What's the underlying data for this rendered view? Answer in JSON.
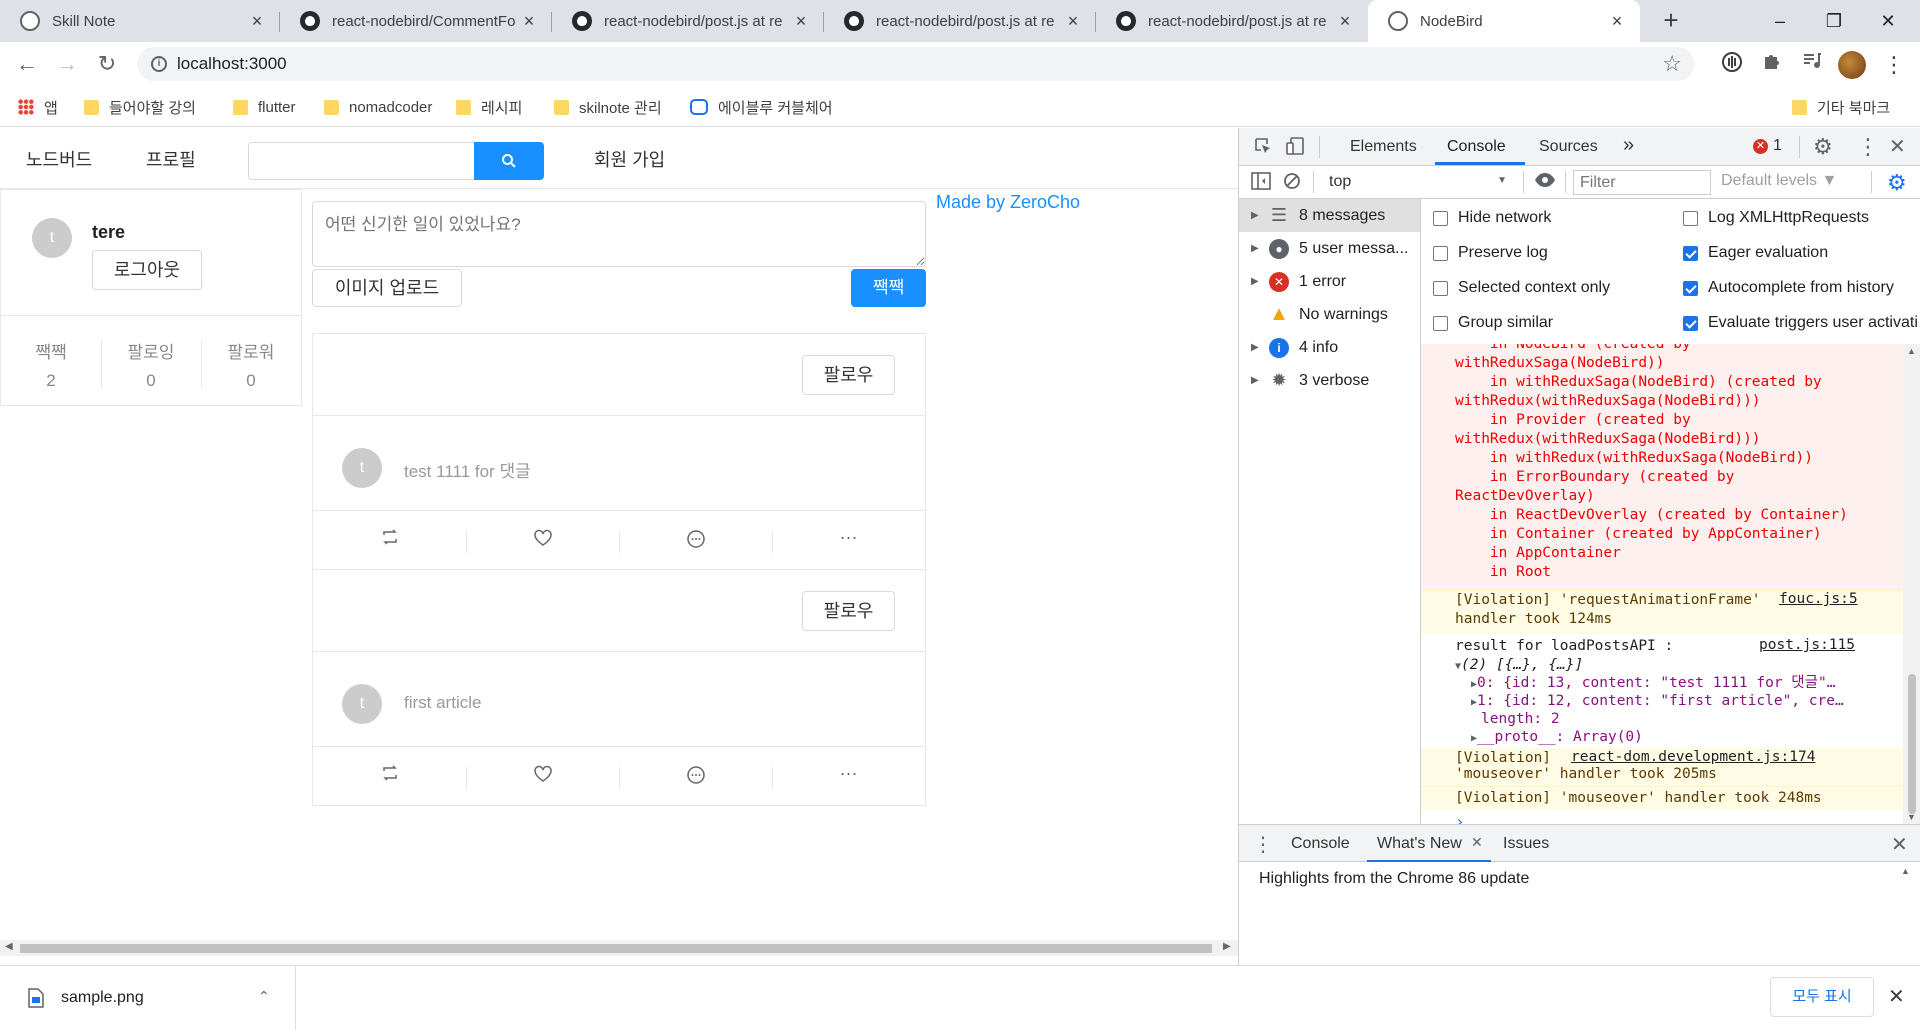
{
  "tabs": [
    {
      "title": "Skill Note",
      "icon": "globe-icon",
      "active": false
    },
    {
      "title": "react-nodebird/CommentFo",
      "icon": "github-icon",
      "active": false
    },
    {
      "title": "react-nodebird/post.js at re",
      "icon": "github-icon",
      "active": false
    },
    {
      "title": "react-nodebird/post.js at re",
      "icon": "github-icon",
      "active": false
    },
    {
      "title": "react-nodebird/post.js at re",
      "icon": "github-icon",
      "active": false
    },
    {
      "title": "NodeBird",
      "icon": "globe-icon",
      "active": true
    }
  ],
  "window": {
    "new_tab": "+",
    "minimize": "–",
    "maximize": "❐",
    "close": "✕"
  },
  "toolbar": {
    "back": "←",
    "forward": "→",
    "reload": "↻",
    "url": "localhost:3000",
    "star": "☆"
  },
  "bookmarks": {
    "items": [
      "앱",
      "들어야할 강의",
      "flutter",
      "nomadcoder",
      "레시피",
      "skilnote 관리",
      "에이블루 커블체어"
    ],
    "other": "기타 북마크"
  },
  "app": {
    "menu": {
      "home": "노드버드",
      "profile": "프로필",
      "signup": "회원 가입"
    },
    "search": {
      "placeholder": "",
      "button_icon": "search-icon"
    },
    "user": {
      "avatar_letter": "t",
      "nickname": "tere",
      "logout": "로그아웃"
    },
    "stats": [
      {
        "label": "짹짹",
        "value": "2"
      },
      {
        "label": "팔로잉",
        "value": "0"
      },
      {
        "label": "팔로워",
        "value": "0"
      }
    ],
    "post_form": {
      "placeholder": "어떤 신기한 일이 있었나요?",
      "upload": "이미지 업로드",
      "submit": "짹짹"
    },
    "made_by": "Made by ZeroCho",
    "posts": [
      {
        "avatar_letter": "t",
        "content": "test 1111 for 댓글",
        "follow": "팔로우"
      },
      {
        "avatar_letter": "t",
        "content": "first article",
        "follow": "팔로우"
      }
    ],
    "post_actions": [
      "retweet-icon",
      "heart-icon",
      "comment-icon",
      "ellipsis-icon"
    ],
    "ellipsis": "···"
  },
  "devtools": {
    "tabs": [
      "Elements",
      "Console",
      "Sources"
    ],
    "more": "»",
    "error_count": "1",
    "context": "top",
    "filter_placeholder": "Filter",
    "levels": "Default levels ▼",
    "sidebar": [
      {
        "label": "8 messages",
        "icon": "list-icon"
      },
      {
        "label": "5 user messa...",
        "icon": "user-icon"
      },
      {
        "label": "1 error",
        "icon": "error-icon"
      },
      {
        "label": "No warnings",
        "icon": "warning-icon"
      },
      {
        "label": "4 info",
        "icon": "info-icon"
      },
      {
        "label": "3 verbose",
        "icon": "bug-icon"
      }
    ],
    "settings_left": [
      {
        "label": "Hide network",
        "checked": false
      },
      {
        "label": "Preserve log",
        "checked": false
      },
      {
        "label": "Selected context only",
        "checked": false
      },
      {
        "label": "Group similar",
        "checked": false
      }
    ],
    "settings_right": [
      {
        "label": "Log XMLHttpRequests",
        "checked": false
      },
      {
        "label": "Eager evaluation",
        "checked": true
      },
      {
        "label": "Autocomplete from history",
        "checked": true
      },
      {
        "label": "Evaluate triggers user activati",
        "checked": true
      }
    ],
    "error_lines": [
      "    in NodeBird (created by",
      "withReduxSaga(NodeBird))",
      "    in withReduxSaga(NodeBird) (created by",
      "withRedux(withReduxSaga(NodeBird)))",
      "    in Provider (created by",
      "withRedux(withReduxSaga(NodeBird)))",
      "    in withRedux(withReduxSaga(NodeBird))",
      "    in ErrorBoundary (created by",
      "ReactDevOverlay)",
      "    in ReactDevOverlay (created by Container)",
      "    in Container (created by AppContainer)",
      "    in AppContainer",
      "    in Root"
    ],
    "violation1": {
      "text1": "[Violation] 'requestAnimationFrame'",
      "text2": "handler took 124ms",
      "source": "fouc.js:5"
    },
    "log": {
      "text": "result for loadPostsAPI :",
      "source": "post.js:115",
      "array": "(2) [{…}, {…}]",
      "items": [
        "0: {id: 13, content: \"test 1111 for 댓글\"…",
        "1: {id: 12, content: \"first article\", cre…"
      ],
      "length": "length: 2",
      "proto": "__proto__: Array(0)"
    },
    "violation2": {
      "text1": "[Violation]",
      "text2": "'mouseover' handler took 205ms",
      "source": "react-dom.development.js:174"
    },
    "violation3": "[Violation] 'mouseover' handler took 248ms",
    "prompt": "›",
    "drawer_tabs": [
      "Console",
      "What's New",
      "Issues"
    ],
    "drawer_text": "Highlights from the Chrome 86 update"
  },
  "downloads": {
    "file": "sample.png",
    "show_all": "모두 표시"
  },
  "colors": {
    "primary": "#1890ff",
    "devtools_blue": "#1a73e8",
    "error_bg": "#fff0f0",
    "warn_bg": "#fffbe5"
  }
}
